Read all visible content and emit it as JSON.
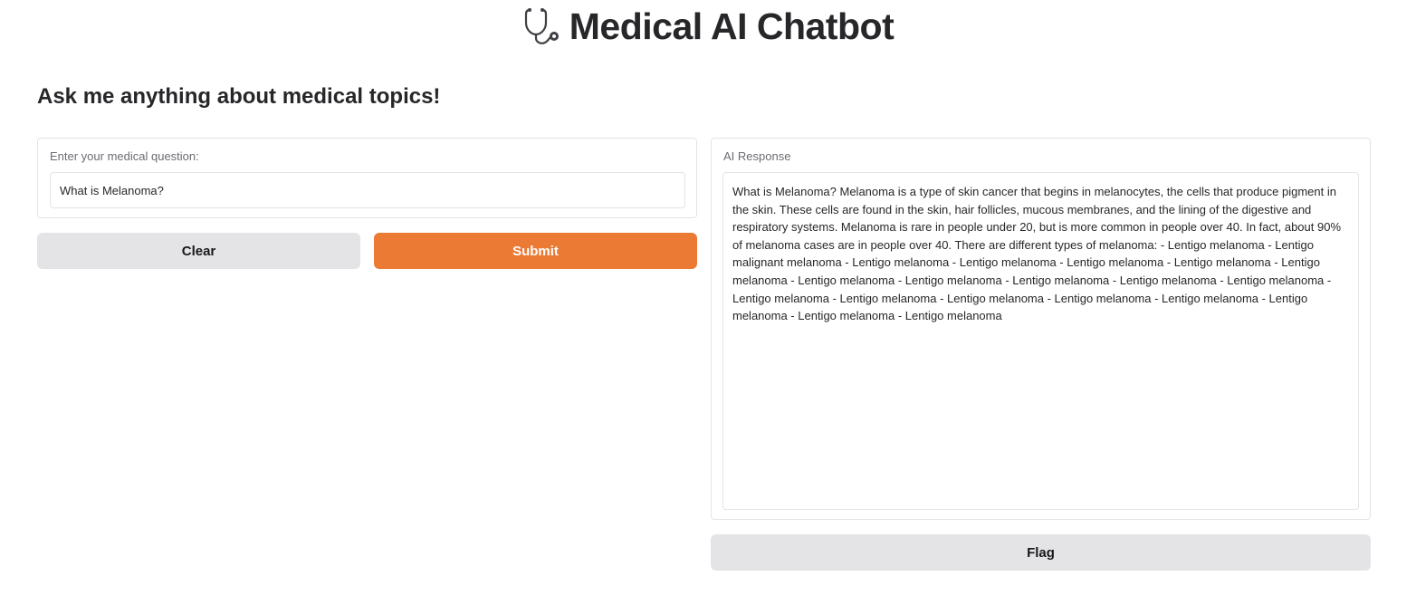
{
  "header": {
    "title": "Medical AI Chatbot",
    "icon": "stethoscope-icon"
  },
  "subtitle": "Ask me anything about medical topics!",
  "question_panel": {
    "label": "Enter your medical question:",
    "value": "What is Melanoma?"
  },
  "buttons": {
    "clear": "Clear",
    "submit": "Submit",
    "flag": "Flag"
  },
  "response_panel": {
    "label": "AI Response",
    "text": "What is Melanoma? Melanoma is a type of skin cancer that begins in melanocytes, the cells that produce pigment in the skin. These cells are found in the skin, hair follicles, mucous membranes, and the lining of the digestive and respiratory systems. Melanoma is rare in people under 20, but is more common in people over 40. In fact, about 90% of melanoma cases are in people over 40. There are different types of melanoma: - Lentigo melanoma - Lentigo malignant melanoma - Lentigo melanoma - Lentigo melanoma - Lentigo melanoma - Lentigo melanoma - Lentigo melanoma - Lentigo melanoma - Lentigo melanoma - Lentigo melanoma - Lentigo melanoma - Lentigo melanoma - Lentigo melanoma - Lentigo melanoma - Lentigo melanoma - Lentigo melanoma - Lentigo melanoma - Lentigo melanoma - Lentigo melanoma - Lentigo melanoma"
  },
  "colors": {
    "primary": "#eb7a35",
    "secondary": "#e4e4e7",
    "border": "#e4e4e7",
    "text": "#27272a"
  }
}
